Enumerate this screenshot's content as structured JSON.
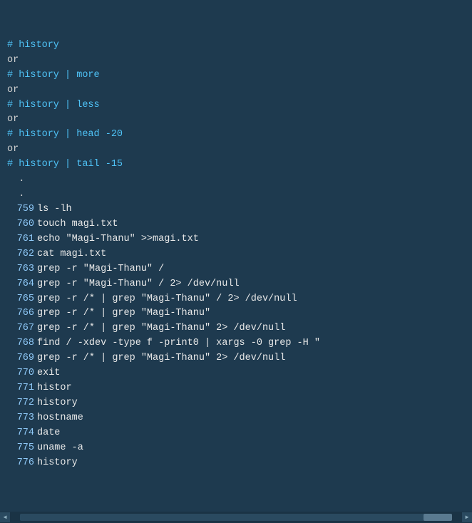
{
  "terminal": {
    "background": "#1e3a4f",
    "lines": [
      {
        "type": "comment",
        "text": "# history"
      },
      {
        "type": "plain",
        "text": "or"
      },
      {
        "type": "comment",
        "text": "# history | more"
      },
      {
        "type": "plain",
        "text": "or"
      },
      {
        "type": "comment",
        "text": "# history | less"
      },
      {
        "type": "plain",
        "text": "or"
      },
      {
        "type": "comment",
        "text": "# history | head -20"
      },
      {
        "type": "plain",
        "text": "or"
      },
      {
        "type": "comment",
        "text": "# history | tail -15"
      },
      {
        "type": "plain",
        "text": "  ."
      },
      {
        "type": "plain",
        "text": "  ."
      },
      {
        "type": "numbered",
        "num": "759",
        "text": "ls -lh"
      },
      {
        "type": "numbered",
        "num": "760",
        "text": "touch magi.txt"
      },
      {
        "type": "numbered",
        "num": "761",
        "text": "echo \"Magi-Thanu\" >>magi.txt"
      },
      {
        "type": "numbered",
        "num": "762",
        "text": "cat magi.txt"
      },
      {
        "type": "numbered",
        "num": "763",
        "text": "grep -r \"Magi-Thanu\" /"
      },
      {
        "type": "numbered",
        "num": "764",
        "text": "grep -r \"Magi-Thanu\" / 2> /dev/null"
      },
      {
        "type": "numbered",
        "num": "765",
        "text": "grep -r /* | grep \"Magi-Thanu\" / 2> /dev/null"
      },
      {
        "type": "numbered",
        "num": "766",
        "text": "grep -r /* | grep \"Magi-Thanu\""
      },
      {
        "type": "numbered",
        "num": "767",
        "text": "grep -r /* | grep \"Magi-Thanu\" 2> /dev/null"
      },
      {
        "type": "numbered",
        "num": "768",
        "text": "find / -xdev -type f -print0 | xargs -0 grep -H \""
      },
      {
        "type": "numbered",
        "num": "769",
        "text": "grep -r /* | grep \"Magi-Thanu\" 2> /dev/null"
      },
      {
        "type": "numbered",
        "num": "770",
        "text": "exit"
      },
      {
        "type": "numbered",
        "num": "771",
        "text": "histor"
      },
      {
        "type": "numbered",
        "num": "772",
        "text": "history"
      },
      {
        "type": "numbered",
        "num": "773",
        "text": "hostname"
      },
      {
        "type": "numbered",
        "num": "774",
        "text": "date"
      },
      {
        "type": "numbered",
        "num": "775",
        "text": "uname -a"
      },
      {
        "type": "numbered",
        "num": "776",
        "text": "history"
      }
    ],
    "scrollbar": {
      "left_btn": "◀",
      "right_btn": "▶"
    }
  }
}
